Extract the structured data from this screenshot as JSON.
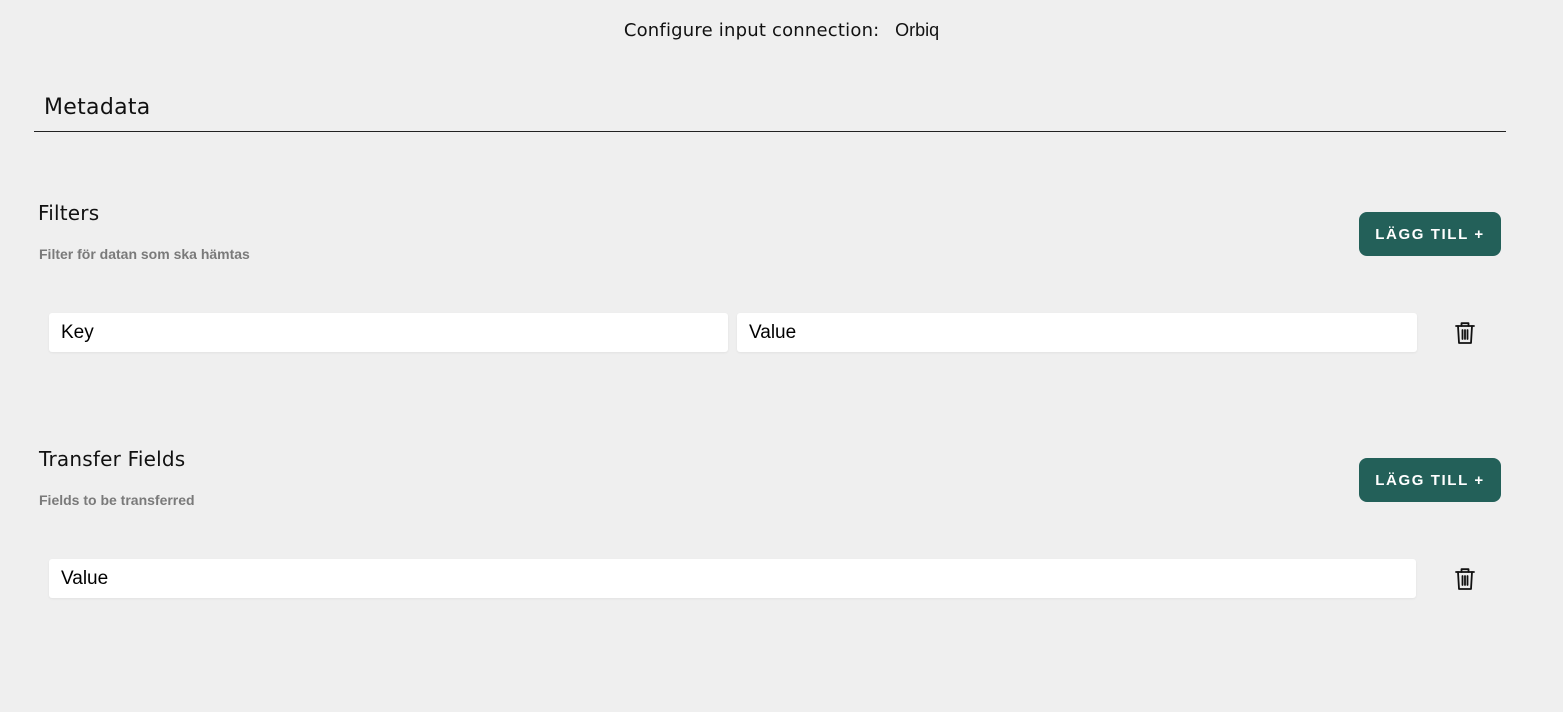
{
  "header": {
    "label": "Configure input connection:",
    "connection_name": "Orbiq"
  },
  "metadata": {
    "title": "Metadata"
  },
  "filters": {
    "title": "Filters",
    "subtitle": "Filter för datan som ska hämtas",
    "add_label": "LÄGG TILL +",
    "row": {
      "key_placeholder": "Key",
      "value_placeholder": "Value",
      "delete_icon": "trash-icon"
    }
  },
  "transfer_fields": {
    "title": "Transfer Fields",
    "subtitle": "Fields to be transferred",
    "add_label": "LÄGG TILL +",
    "row": {
      "value_placeholder": "Value",
      "delete_icon": "trash-icon"
    }
  },
  "colors": {
    "background": "#efefef",
    "accent": "#236059",
    "subtitle": "#7a7a7a"
  }
}
